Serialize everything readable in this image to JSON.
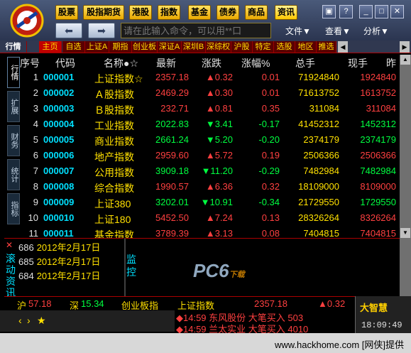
{
  "toolbar": {
    "quick_buttons": [
      "股票",
      "股指期货",
      "港股",
      "指数",
      "基金",
      "债券",
      "商品",
      "资讯"
    ],
    "command_placeholder": "请在此输入命令，可以用**口",
    "menus": [
      "文件▼",
      "查看▼",
      "分析▼"
    ]
  },
  "tabs": [
    "行情",
    "主页",
    "自选",
    "上证A",
    "期指",
    "创业板",
    "深证A",
    "深圳B",
    "深综权",
    "沪股",
    "特定",
    "选股",
    "地区",
    "推选"
  ],
  "side_tabs": [
    "行情",
    "扩展",
    "财务",
    "统计",
    "指标"
  ],
  "columns": [
    "序号",
    "代码",
    "名称●☆",
    "最新",
    "涨跌",
    "涨幅%",
    "总手",
    "现手",
    "昨"
  ],
  "rows": [
    {
      "n": "1",
      "code": "000001",
      "name": "上证指数☆",
      "last": "2357.18",
      "chg": "▲0.32",
      "pct": "0.01",
      "vol": "71924840",
      "cur": "1924840",
      "dir": "up"
    },
    {
      "n": "2",
      "code": "000002",
      "name": "Ａ股指数",
      "last": "2469.29",
      "chg": "▲0.30",
      "pct": "0.01",
      "vol": "71613752",
      "cur": "1613752",
      "dir": "up"
    },
    {
      "n": "3",
      "code": "000003",
      "name": "Ｂ股指数",
      "last": "232.71",
      "chg": "▲0.81",
      "pct": "0.35",
      "vol": "311084",
      "cur": "311084",
      "dir": "up"
    },
    {
      "n": "4",
      "code": "000004",
      "name": "工业指数",
      "last": "2022.83",
      "chg": "▼3.41",
      "pct": "-0.17",
      "vol": "41452312",
      "cur": "1452312",
      "dir": "down"
    },
    {
      "n": "5",
      "code": "000005",
      "name": "商业指数",
      "last": "2661.24",
      "chg": "▼5.20",
      "pct": "-0.20",
      "vol": "2374179",
      "cur": "2374179",
      "dir": "down"
    },
    {
      "n": "6",
      "code": "000006",
      "name": "地产指数",
      "last": "2959.60",
      "chg": "▲5.72",
      "pct": "0.19",
      "vol": "2506366",
      "cur": "2506366",
      "dir": "up"
    },
    {
      "n": "7",
      "code": "000007",
      "name": "公用指数",
      "last": "3909.18",
      "chg": "▼11.20",
      "pct": "-0.29",
      "vol": "7482984",
      "cur": "7482984",
      "dir": "down"
    },
    {
      "n": "8",
      "code": "000008",
      "name": "综合指数",
      "last": "1990.57",
      "chg": "▲6.36",
      "pct": "0.32",
      "vol": "18109000",
      "cur": "8109000",
      "dir": "up"
    },
    {
      "n": "9",
      "code": "000009",
      "name": "上证380",
      "last": "3202.01",
      "chg": "▼10.91",
      "pct": "-0.34",
      "vol": "21729550",
      "cur": "1729550",
      "dir": "down"
    },
    {
      "n": "10",
      "code": "000010",
      "name": "上证180",
      "last": "5452.50",
      "chg": "▲7.24",
      "pct": "0.13",
      "vol": "28326264",
      "cur": "8326264",
      "dir": "up"
    },
    {
      "n": "11",
      "code": "000011",
      "name": "基金指数",
      "last": "3789.39",
      "chg": "▲3.13",
      "pct": "0.08",
      "vol": "7404815",
      "cur": "7404815",
      "dir": "up"
    }
  ],
  "scroll_panel": {
    "label": "滚动资讯",
    "items": [
      {
        "code": "686",
        "date": "2012年2月17日"
      },
      {
        "code": "685",
        "date": "2012年2月17日"
      },
      {
        "code": "684",
        "date": "2012年2月17日"
      }
    ]
  },
  "monitor": {
    "label": "监控",
    "watermark": "PC6",
    "watermark_sub": "下载"
  },
  "status": {
    "sh_label": "沪",
    "sh_value": "57.18",
    "sz_label": "深",
    "sz_value": "15.34",
    "board": "创业板指"
  },
  "ticker": {
    "name": "上证指数",
    "value": "2357.18",
    "chg": "▲0.32"
  },
  "news": [
    "◆14:59 东风股份 大笔买入 503",
    "◆14:59 兰太实业 大笔买入 4010"
  ],
  "brand": {
    "name": "大智慧",
    "time": "18:09:49"
  },
  "footer": "www.hackhome.com [网侠]提供"
}
